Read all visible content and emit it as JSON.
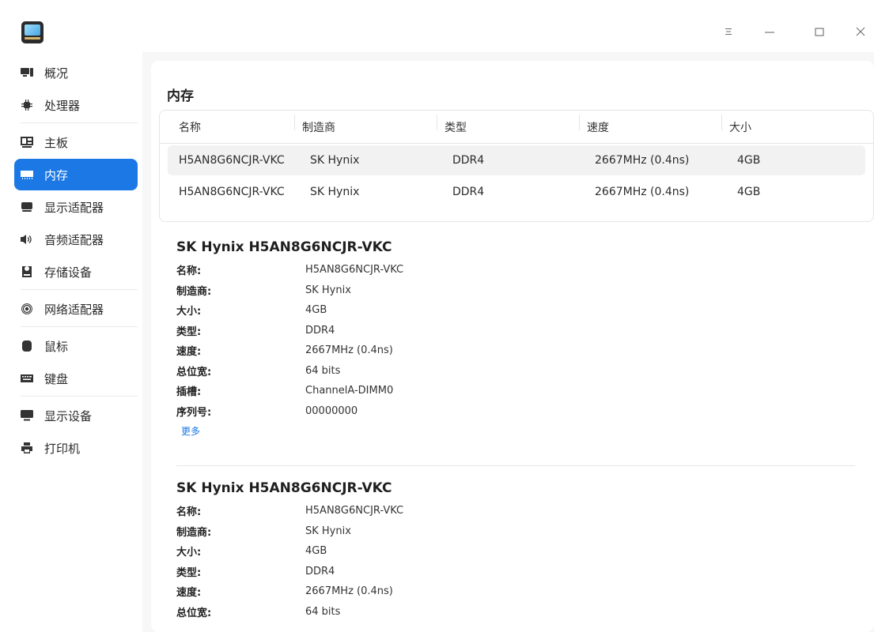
{
  "window": {
    "controls": [
      "menu-icon",
      "minimize-icon",
      "maximize-icon",
      "close-icon"
    ]
  },
  "sidebar": {
    "items": [
      {
        "label": "概况",
        "icon": "monitor-overview-icon"
      },
      {
        "label": "处理器",
        "icon": "cpu-icon"
      },
      {
        "label": "主板",
        "icon": "motherboard-icon"
      },
      {
        "label": "内存",
        "icon": "memory-icon",
        "active": true
      },
      {
        "label": "显示适配器",
        "icon": "display-adapter-icon"
      },
      {
        "label": "音频适配器",
        "icon": "speaker-icon"
      },
      {
        "label": "存储设备",
        "icon": "storage-icon"
      },
      {
        "label": "网络适配器",
        "icon": "network-icon"
      },
      {
        "label": "鼠标",
        "icon": "mouse-icon"
      },
      {
        "label": "键盘",
        "icon": "keyboard-icon"
      },
      {
        "label": "显示设备",
        "icon": "monitor-icon"
      },
      {
        "label": "打印机",
        "icon": "printer-icon"
      }
    ]
  },
  "main": {
    "title": "内存",
    "table": {
      "headers": [
        "名称",
        "制造商",
        "类型",
        "速度",
        "大小"
      ],
      "rows": [
        [
          "H5AN8G6NCJR-VKC",
          "SK Hynix",
          "DDR4",
          "2667MHz (0.4ns)",
          "4GB"
        ],
        [
          "H5AN8G6NCJR-VKC",
          "SK Hynix",
          "DDR4",
          "2667MHz (0.4ns)",
          "4GB"
        ]
      ]
    },
    "details": [
      {
        "title": "SK Hynix H5AN8G6NCJR-VKC",
        "fields": [
          {
            "k": "名称:",
            "v": "H5AN8G6NCJR-VKC"
          },
          {
            "k": "制造商:",
            "v": "SK Hynix"
          },
          {
            "k": "大小:",
            "v": "4GB"
          },
          {
            "k": "类型:",
            "v": "DDR4"
          },
          {
            "k": "速度:",
            "v": "2667MHz (0.4ns)"
          },
          {
            "k": "总位宽:",
            "v": "64 bits"
          },
          {
            "k": "插槽:",
            "v": "ChannelA-DIMM0"
          },
          {
            "k": "序列号:",
            "v": "00000000"
          }
        ],
        "more_label": "更多"
      },
      {
        "title": "SK Hynix H5AN8G6NCJR-VKC",
        "fields": [
          {
            "k": "名称:",
            "v": "H5AN8G6NCJR-VKC"
          },
          {
            "k": "制造商:",
            "v": "SK Hynix"
          },
          {
            "k": "大小:",
            "v": "4GB"
          },
          {
            "k": "类型:",
            "v": "DDR4"
          },
          {
            "k": "速度:",
            "v": "2667MHz (0.4ns)"
          },
          {
            "k": "总位宽:",
            "v": "64 bits"
          }
        ]
      }
    ]
  },
  "colors": {
    "accent": "#1b78e5",
    "content_bg": "#f7f7f7"
  }
}
